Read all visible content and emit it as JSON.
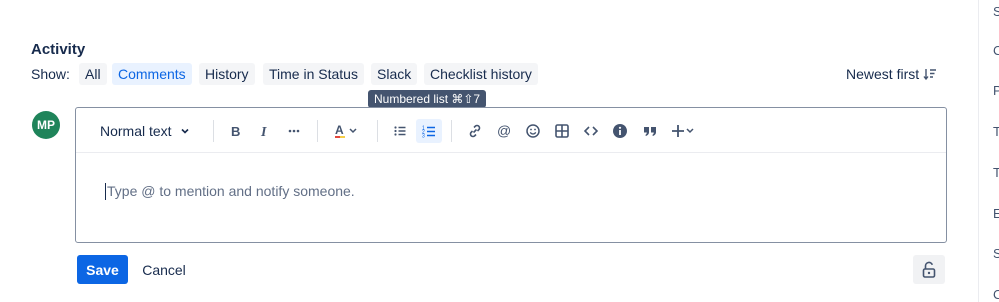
{
  "activity": {
    "title": "Activity",
    "show_label": "Show:",
    "filters": [
      {
        "label": "All",
        "active": false
      },
      {
        "label": "Comments",
        "active": true
      },
      {
        "label": "History",
        "active": false
      },
      {
        "label": "Time in Status",
        "active": false
      },
      {
        "label": "Slack",
        "active": false
      },
      {
        "label": "Checklist history",
        "active": false
      }
    ],
    "sort_label": "Newest first"
  },
  "tooltip": {
    "text": "Numbered list ⌘⇧7"
  },
  "avatar": {
    "initials": "MP",
    "color": "#1f845a"
  },
  "editor": {
    "text_style": "Normal text",
    "placeholder": "Type @ to mention and notify someone.",
    "toolbar_icons": [
      "bold-icon",
      "italic-icon",
      "more-formatting-icon",
      "text-color-icon",
      "bullet-list-icon",
      "numbered-list-icon",
      "link-icon",
      "mention-icon",
      "emoji-icon",
      "table-icon",
      "code-icon",
      "info-panel-icon",
      "quote-icon",
      "insert-more-icon"
    ],
    "selected_tool": "numbered-list-icon"
  },
  "actions": {
    "save_label": "Save",
    "cancel_label": "Cancel"
  },
  "right_strip": {
    "letters": [
      "S",
      "C",
      "P",
      "T",
      "T",
      "E",
      "S",
      "C"
    ]
  },
  "colors": {
    "accent": "#0c66e4",
    "avatar": "#1f845a",
    "tooltip_bg": "#44546f"
  }
}
